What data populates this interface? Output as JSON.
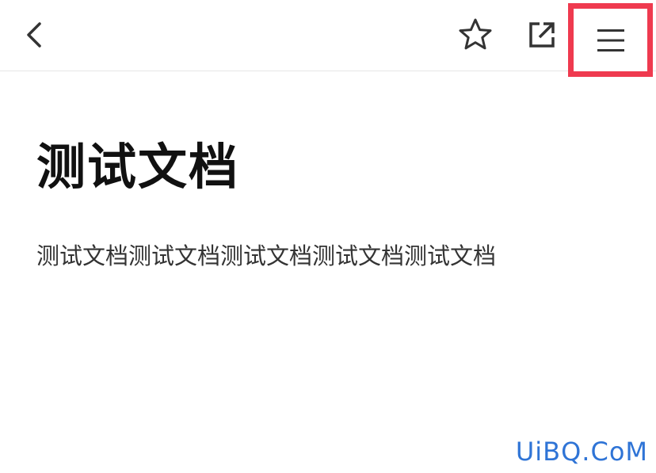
{
  "toolbar": {
    "back_icon": "chevron-left-icon",
    "favorite_icon": "star-outline-icon",
    "share_icon": "external-link-icon",
    "menu_icon": "hamburger-menu-icon",
    "highlight_color": "#ef3a4f"
  },
  "document": {
    "title": "测试文档",
    "body": "测试文档测试文档测试文档测试文档测试文档"
  },
  "watermark": {
    "text": "UiBQ.CoM",
    "color": "#2f74d6"
  }
}
